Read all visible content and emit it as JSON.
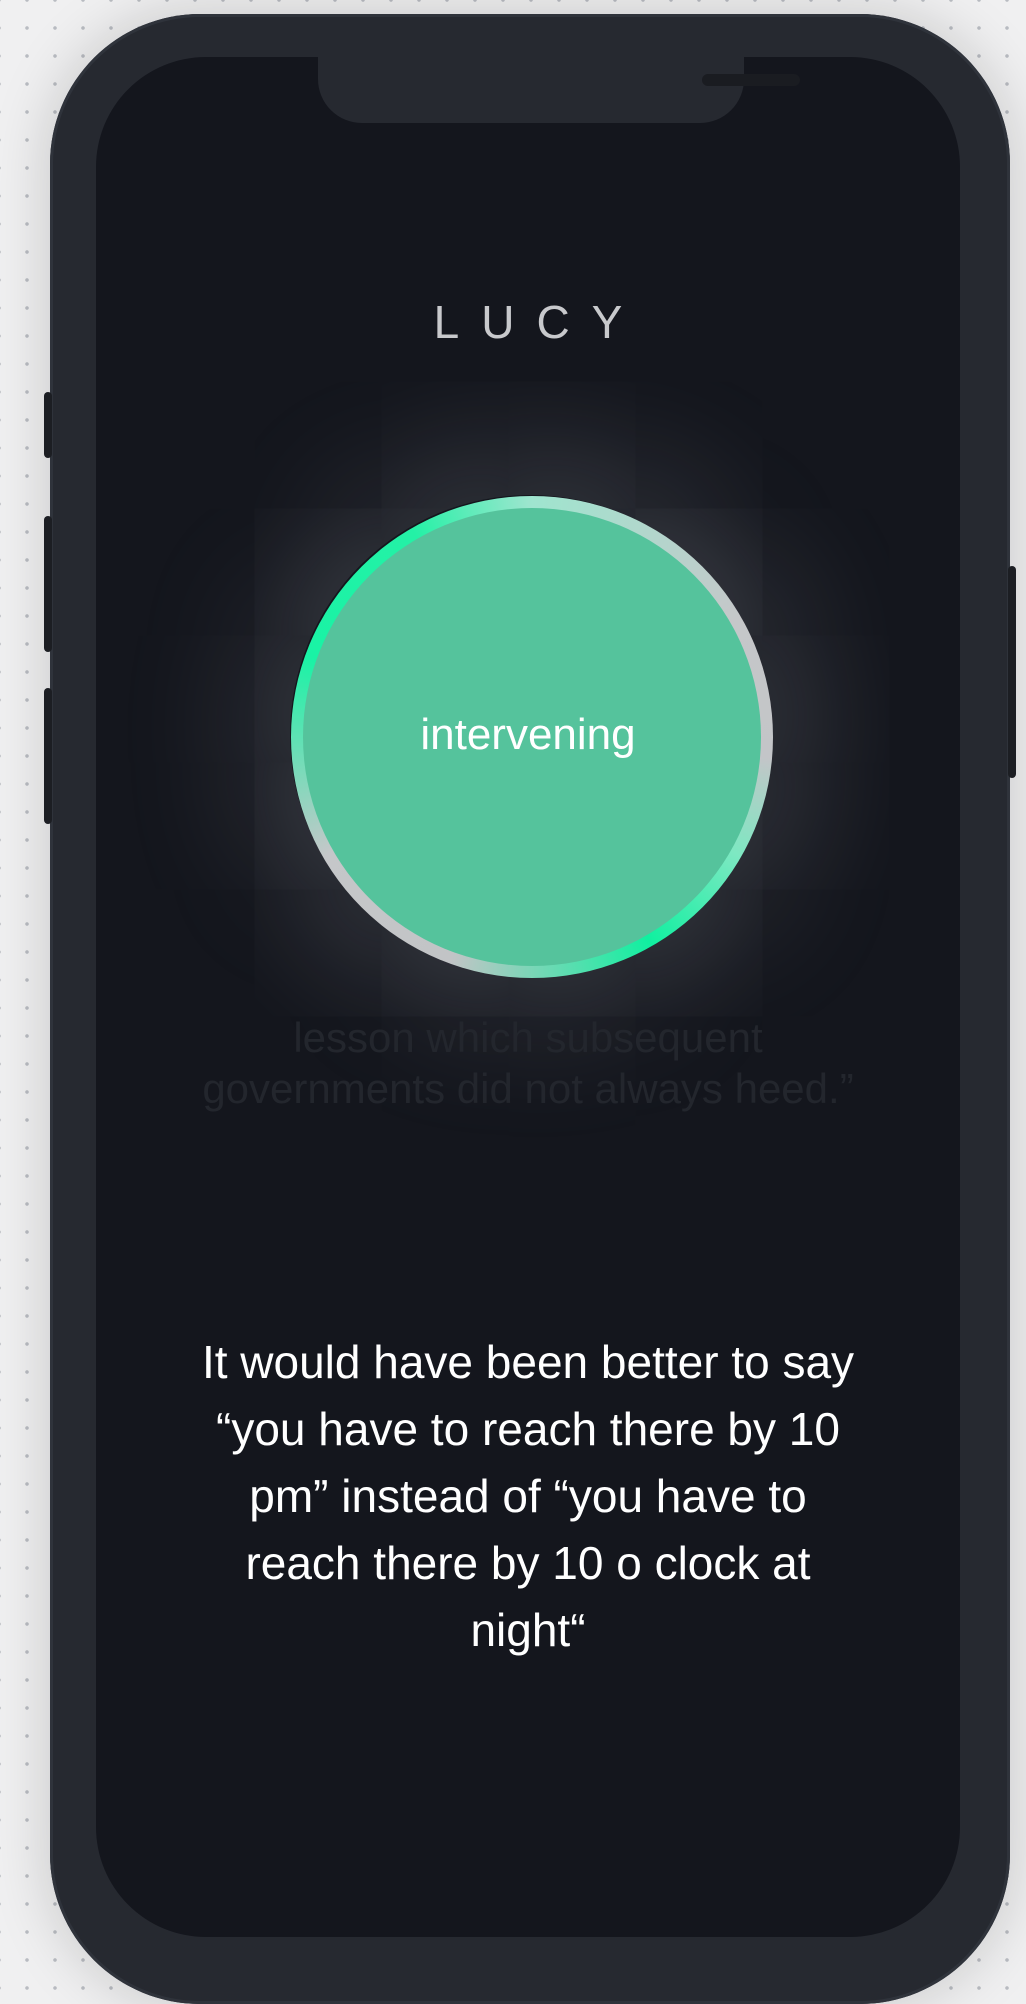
{
  "app": {
    "title": "LUCY"
  },
  "orb": {
    "status": "intervening",
    "colors": {
      "fill": "#55c39c",
      "ring_accent": "#10f0a0",
      "ring_neutral": "#c5c7c9"
    }
  },
  "transcript": {
    "previous": "lesson which subsequent governments did not always heed.”",
    "current": "It would have been better to say “you have to reach there by 10 pm” instead of “you have to reach there by 10 o clock at night“"
  },
  "theme": {
    "screen_background": "#14161d",
    "device_frame": "#262930",
    "text_primary": "#ffffff",
    "text_muted": "#23262d"
  }
}
